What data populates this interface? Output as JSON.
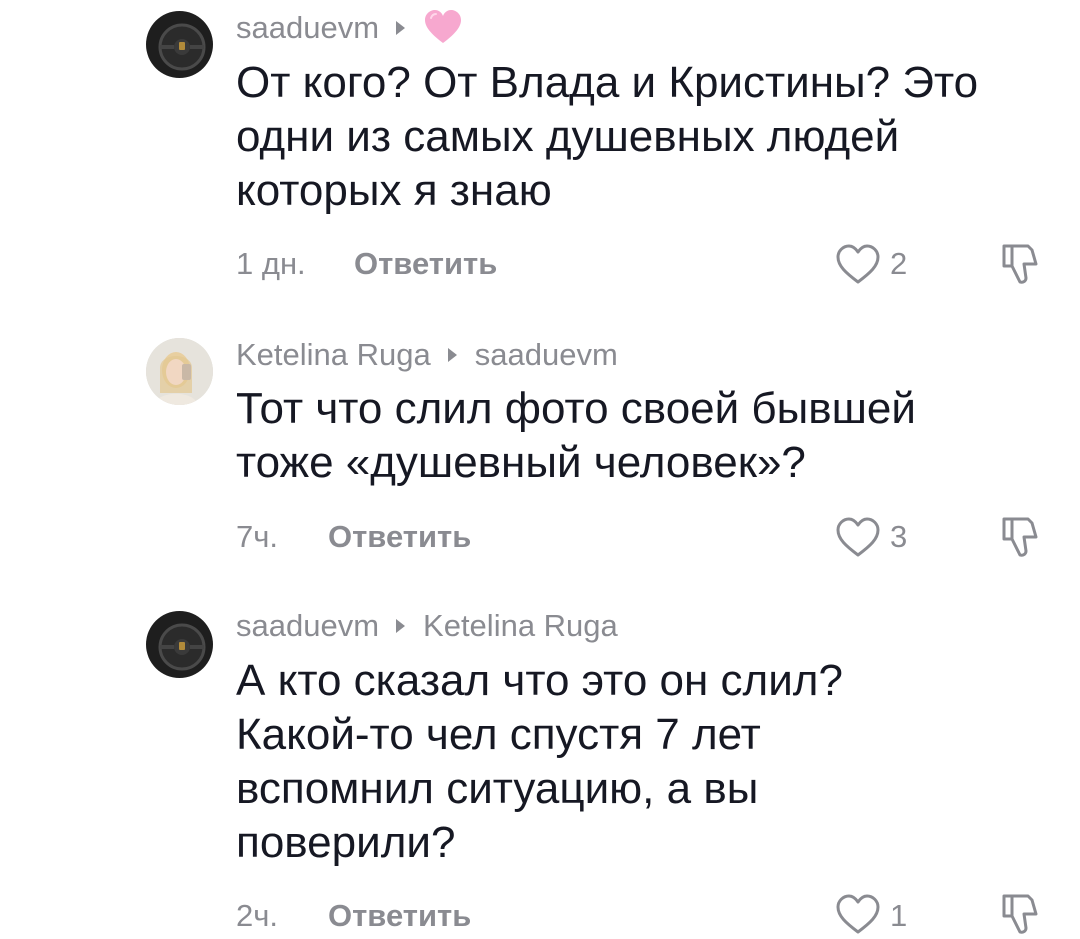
{
  "comments": [
    {
      "author": "saaduevm",
      "reply_to": "",
      "text_lines": [
        "От кого? От Влада и Кристины? Это",
        "одни из самых душевных людей",
        "которых я знаю"
      ],
      "time": "1 дн.",
      "reply_label": "Ответить",
      "likes": "2",
      "avatar": "steering-wheel-photo",
      "badge_icon": "pink-heart-icon"
    },
    {
      "author": "Ketelina Ruga",
      "reply_to": "saaduevm",
      "text_lines": [
        "Тот что слил фото своей бывшей",
        "тоже «душевный человек»?"
      ],
      "time": "7ч.",
      "reply_label": "Ответить",
      "likes": "3",
      "avatar": "selfie-photo"
    },
    {
      "author": "saaduevm",
      "reply_to": "Ketelina Ruga",
      "text_lines": [
        "А кто сказал что это он слил?",
        "Какой-то чел спустя 7 лет",
        "вспомнил ситуацию, а вы",
        "поверили?"
      ],
      "time": "2ч.",
      "reply_label": "Ответить",
      "likes": "1",
      "avatar": "steering-wheel-photo"
    }
  ],
  "icons": {
    "like": "heart-outline-icon",
    "dislike": "thumbs-down-icon",
    "reply_arrow": "reply-arrow-icon"
  },
  "colors": {
    "text": "#161823",
    "muted": "#8a8b91",
    "badge_pink": "#f7a8cf"
  }
}
